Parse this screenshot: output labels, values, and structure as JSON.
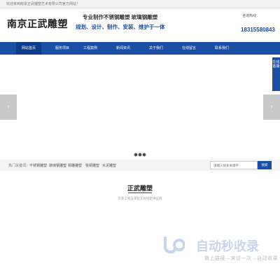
{
  "topbar": {
    "welcome": "欢迎来到南京正武雕塑艺术有限公司官方网站！"
  },
  "header": {
    "logo": "南京正武雕塑",
    "slogan_line1": "专业制作不锈钢雕塑 玻璃钢雕塑",
    "slogan_line2": "规划、设计、制作、安装、维护于一体",
    "hotline_label": "咨询热线：",
    "hotline_number": "18315580843"
  },
  "nav": {
    "items": [
      {
        "label": "网站首页"
      },
      {
        "label": "服务项目"
      },
      {
        "label": "工程案例"
      },
      {
        "label": "新闻资讯"
      },
      {
        "label": "关于我们"
      },
      {
        "label": "在线留言"
      },
      {
        "label": "联系我们"
      }
    ]
  },
  "side_tab": {
    "label": "在线客服"
  },
  "banner": {
    "prev_glyph": "‹",
    "next_glyph": "›",
    "slide_count": 3
  },
  "keywords": {
    "label": "热门关键词：",
    "items": [
      "不锈钢雕塑",
      "玻璃钢雕塑",
      "铜雕雕塑",
      "铁铜雕塑",
      "水泥雕塑"
    ]
  },
  "search": {
    "placeholder": "请输入搜索关键字",
    "button_label": "搜索"
  },
  "section": {
    "title": "正武雕塑",
    "subtitle": "众多工程五单位工程指定供应商"
  },
  "watermark": {
    "text": "自动秒收录",
    "slogan": "做上链接→来访一次→自动收录"
  },
  "colors": {
    "brand": "#1a4fa5",
    "nav_active": "#0d3c8c"
  }
}
